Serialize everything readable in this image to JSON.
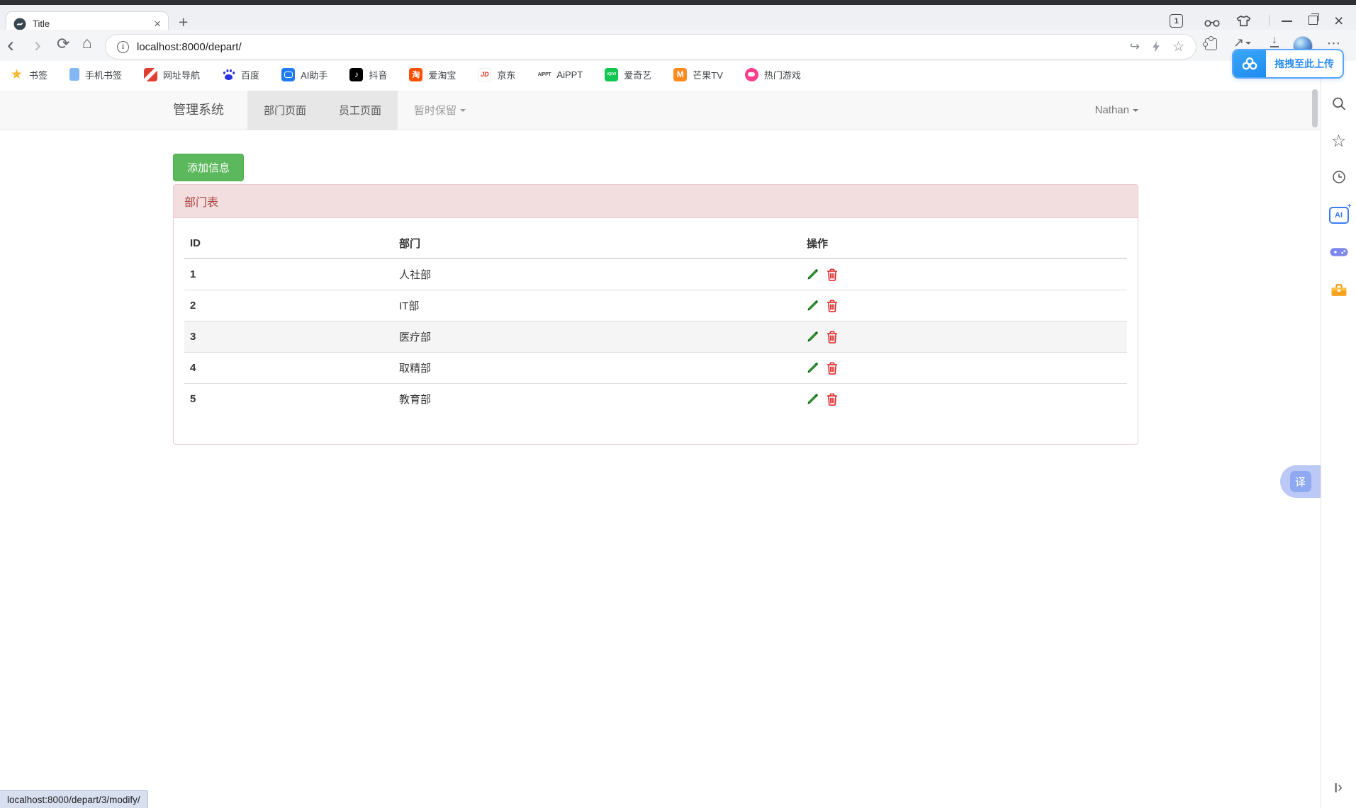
{
  "browser": {
    "frame": {
      "tab_count_badge": "1",
      "icons": [
        "tab-count-icon",
        "glasses-icon",
        "theme-shirt-icon",
        "minimize-icon",
        "maximize-restore-icon",
        "close-icon"
      ]
    },
    "tab": {
      "title": "Title",
      "close_glyph": "×",
      "new_tab_glyph": "+"
    },
    "toolbar": {
      "url": "localhost:8000/depart/",
      "icons": [
        "back-icon",
        "forward-icon",
        "refresh-icon",
        "home-icon",
        "page-info-icon",
        "share-icon",
        "lightning-icon",
        "bookmark-star-icon",
        "extensions-puzzle-icon",
        "send-to-device-icon",
        "download-icon",
        "profile-avatar",
        "more-menu-icon"
      ]
    },
    "bookmarks": [
      {
        "label": "书签",
        "icon": "star-bookmark-icon",
        "glyph": "★"
      },
      {
        "label": "手机书签",
        "icon": "phone-bookmark-icon"
      },
      {
        "label": "网址导航",
        "icon": "site-nav-icon"
      },
      {
        "label": "百度",
        "icon": "baidu-icon"
      },
      {
        "label": "AI助手",
        "icon": "ai-assistant-icon"
      },
      {
        "label": "抖音",
        "icon": "douyin-icon",
        "glyph": "♪"
      },
      {
        "label": "爱淘宝",
        "icon": "taobao-icon",
        "glyph": "淘"
      },
      {
        "label": "京东",
        "icon": "jd-icon",
        "glyph": "JD"
      },
      {
        "label": "AiPPT",
        "icon": "aippt-icon",
        "glyph": "AIPPT"
      },
      {
        "label": "爱奇艺",
        "icon": "iqiyi-icon",
        "glyph": "iQIYI"
      },
      {
        "label": "芒果TV",
        "icon": "mgtv-icon",
        "glyph": "M"
      },
      {
        "label": "热门游戏",
        "icon": "hot-games-icon"
      }
    ],
    "upload_overlay": {
      "label": "拖拽至此上传",
      "icon": "netdisk-logo-icon"
    },
    "translate_button": {
      "label": "译"
    },
    "side_panel": {
      "icons": [
        "search-icon",
        "favorites-star-icon",
        "history-clock-icon",
        "ai-panel-icon",
        "gamepad-icon",
        "toolbox-icon",
        "collapse-panel-icon"
      ],
      "ai_badge": "AI"
    },
    "status_bar": {
      "link_preview": "localhost:8000/depart/3/modify/"
    }
  },
  "page": {
    "navbar": {
      "brand": "管理系统",
      "items": [
        {
          "label": "部门页面",
          "active": true
        },
        {
          "label": "员工页面",
          "active": true
        },
        {
          "label": "暂时保留",
          "dropdown": true
        }
      ],
      "user_menu": "Nathan"
    },
    "add_button": "添加信息",
    "panel": {
      "title": "部门表",
      "table": {
        "headers": [
          "ID",
          "部门",
          "操作"
        ],
        "action_icons": [
          "edit-pencil-icon",
          "delete-trash-icon"
        ],
        "rows": [
          {
            "id": "1",
            "department": "人社部"
          },
          {
            "id": "2",
            "department": "IT部"
          },
          {
            "id": "3",
            "department": "医疗部",
            "highlighted": true
          },
          {
            "id": "4",
            "department": "取精部"
          },
          {
            "id": "5",
            "department": "教育部"
          }
        ]
      }
    }
  }
}
